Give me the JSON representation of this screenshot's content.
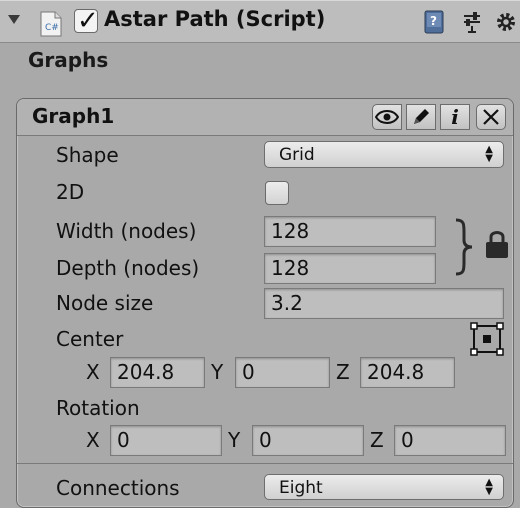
{
  "component": {
    "title": "Astar Path (Script)",
    "enabled": true,
    "icons": [
      "fold-arrow-icon",
      "csharp-script-icon",
      "book-help-icon",
      "sliders-preset-icon",
      "gear-icon"
    ]
  },
  "section": {
    "label": "Graphs"
  },
  "graph": {
    "name": "Graph1",
    "buttons": [
      "eye-icon",
      "pencil-icon",
      "info-icon",
      "close-icon"
    ],
    "shape": {
      "label": "Shape",
      "value": "Grid"
    },
    "two_d": {
      "label": "2D",
      "checked": false
    },
    "width": {
      "label": "Width (nodes)",
      "value": "128"
    },
    "depth": {
      "label": "Depth (nodes)",
      "value": "128"
    },
    "node_size": {
      "label": "Node size",
      "value": "3.2"
    },
    "center": {
      "label": "Center",
      "x_label": "X",
      "x": "204.8",
      "y_label": "Y",
      "y": "0",
      "z_label": "Z",
      "z": "204.8"
    },
    "rotation": {
      "label": "Rotation",
      "x_label": "X",
      "x": "0",
      "y_label": "Y",
      "y": "0",
      "z_label": "Z",
      "z": "0"
    },
    "connections": {
      "label": "Connections",
      "value": "Eight"
    }
  },
  "colors": {
    "panel": "#a9a9a9",
    "header": "#bdbdbd",
    "field": "#bebebe"
  }
}
